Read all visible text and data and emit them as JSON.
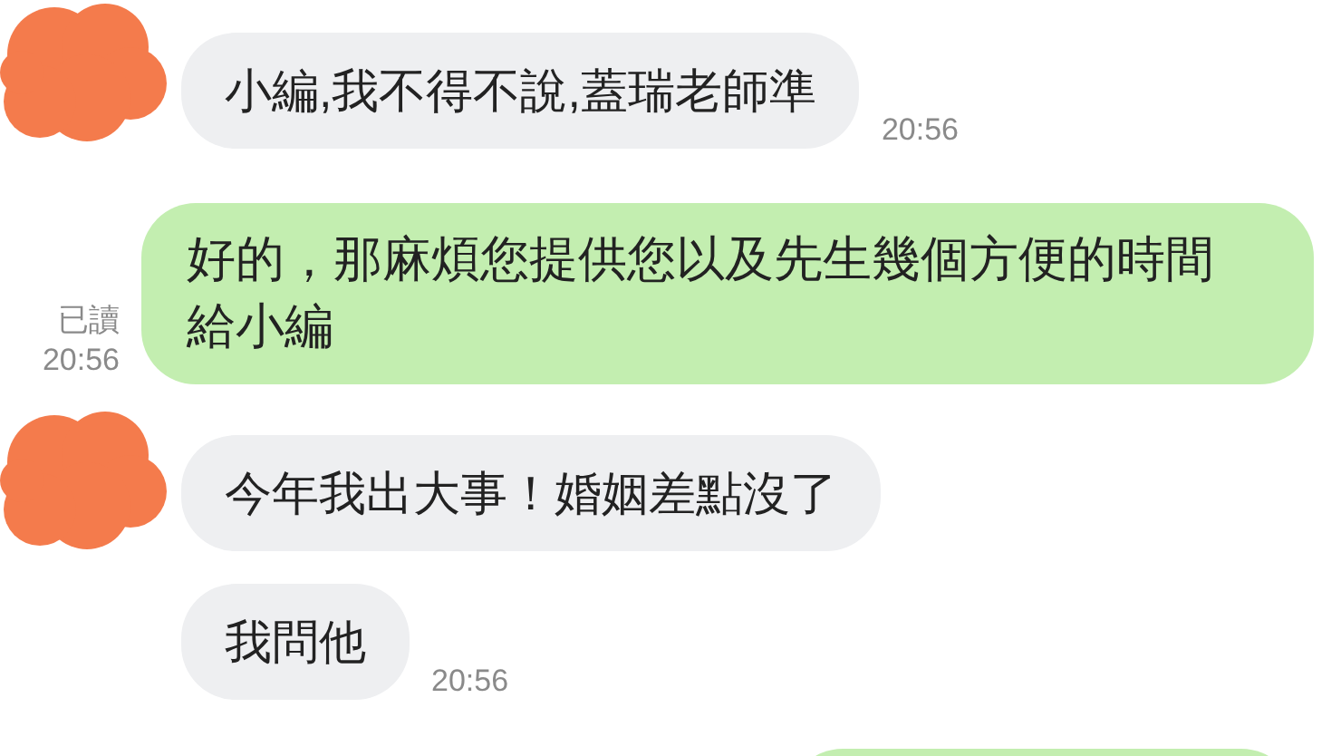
{
  "messages": [
    {
      "kind": "incoming",
      "avatar_hidden": true,
      "text": "小編,我不得不說,蓋瑞老師準",
      "time": "20:56"
    },
    {
      "kind": "outgoing",
      "text": "好的，那麻煩您提供您以及先生幾個方便的時間給小編",
      "read": "已讀",
      "time": "20:56"
    },
    {
      "kind": "incoming",
      "avatar_hidden": true,
      "text": "今年我出大事！婚姻差點沒了"
    },
    {
      "kind": "incoming",
      "avatar_hidden": false,
      "text": "我問他",
      "time": "20:56"
    },
    {
      "kind": "outgoing_cut"
    }
  ]
}
